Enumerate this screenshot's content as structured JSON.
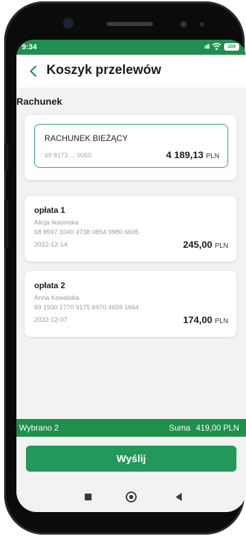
{
  "status_bar": {
    "time": "9:34",
    "signal": "all",
    "battery": "100"
  },
  "header": {
    "title": "Koszyk przelewów"
  },
  "account_section": {
    "title": "Rachunek",
    "account": {
      "name": "RACHUNEK BIEŻĄCY",
      "number": "49 8173 ... 0050",
      "balance_main": "4 189,13",
      "currency": "PLN"
    }
  },
  "payments": [
    {
      "title": "opłata 1",
      "recipient": "Alicja Ikasińska",
      "account": "68 8597 1040 4738 0854 9980 6605",
      "date": "2022-12-14",
      "amount": "245,00",
      "currency": "PLN"
    },
    {
      "title": "opłata 2",
      "recipient": "Anna Kowalska",
      "account": "69 1930 1770 9175 6970 4659 1664",
      "date": "2022-12-07",
      "amount": "174,00",
      "currency": "PLN"
    }
  ],
  "summary": {
    "selected": "Wybrano 2",
    "sum_label": "Suma",
    "sum_value": "419,00 PLN"
  },
  "actions": {
    "send_label": "Wyślij"
  },
  "colors": {
    "brand_green": "#1f8f4d",
    "button_green": "#23985a",
    "account_border": "#2aa366"
  }
}
